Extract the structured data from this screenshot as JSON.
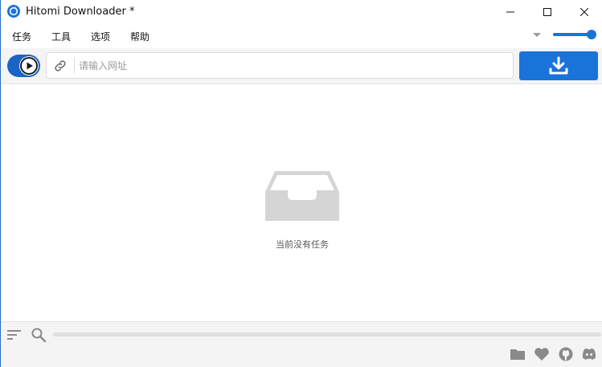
{
  "window": {
    "title": "Hitomi Downloader *",
    "controls": {
      "minimize": "minimize",
      "maximize": "maximize",
      "close": "close"
    }
  },
  "menu": {
    "items": [
      {
        "label": "任务"
      },
      {
        "label": "工具"
      },
      {
        "label": "选项"
      },
      {
        "label": "帮助"
      }
    ]
  },
  "toolbar": {
    "url_placeholder": "请输入网址",
    "url_value": "",
    "play_state": "paused",
    "download_icon": "download-icon"
  },
  "speed_slider": {
    "value": 0.85
  },
  "main": {
    "empty_message": "当前没有任务",
    "empty_icon": "inbox-icon"
  },
  "bottom": {
    "icons": [
      "sort-icon",
      "search-icon",
      "folder-icon",
      "heart-icon",
      "github-icon",
      "discord-icon"
    ]
  },
  "colors": {
    "accent": "#1a73d9",
    "toggle": "#1a64c6",
    "toolbar_bg": "#f4f4f4",
    "icon_gray": "#8a8a8a",
    "empty_icon": "#d5d5d5"
  }
}
